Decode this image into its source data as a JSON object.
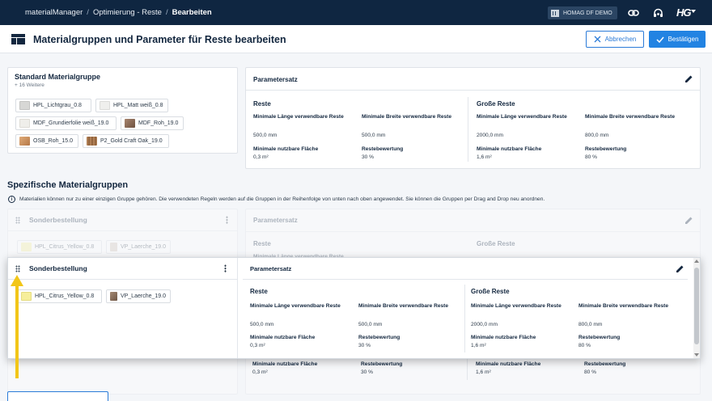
{
  "topnav": {
    "breadcrumbs": [
      "materialManager",
      "Optimierung - Reste",
      "Bearbeiten"
    ],
    "tenant": "HOMAG DF DEMO",
    "logo": "HG"
  },
  "header": {
    "title": "Materialgruppen und Parameter für Reste bearbeiten",
    "cancel_label": "Abbrechen",
    "confirm_label": "Bestätigen"
  },
  "standard": {
    "title": "Standard Materialgruppe",
    "more": "+ 16 Weitere",
    "chips": [
      {
        "label": "HPL_Lichtgrau_0.8",
        "color": "#d7d7d5"
      },
      {
        "label": "HPL_Matt weiß_0.8",
        "color": "#efefed"
      },
      {
        "label": "MDF_Grundierfolie weiß_19.0",
        "color": "#efeeea"
      },
      {
        "label": "MDF_Roh_19.0",
        "color": "#8a6a52"
      },
      {
        "label": "OSB_Roh_15.0",
        "color": "#c98e5a"
      },
      {
        "label": "P2_Gold Craft Oak_19.0",
        "color": "#a0714a"
      }
    ]
  },
  "params_top": {
    "title": "Parametersatz",
    "reste": {
      "title": "Reste",
      "min_len_label": "Minimale Länge verwendbare Reste",
      "min_len": "500,0 mm",
      "min_width_label": "Minimale Breite verwendbare Reste",
      "min_width": "500,0 mm",
      "min_area_label": "Minimale nutzbare Fläche",
      "min_area": "0,3 m²",
      "rating_label": "Restebewertung",
      "rating": "30 %"
    },
    "grosse": {
      "title": "Große Reste",
      "min_len_label": "Minimale Länge verwendbare Reste",
      "min_len": "2000,0 mm",
      "min_width_label": "Minimale Breite verwendbare Reste",
      "min_width": "800,0 mm",
      "min_area_label": "Minimale nutzbare Fläche",
      "min_area": "1,6 m²",
      "rating_label": "Restebewertung",
      "rating": "80 %"
    }
  },
  "specific": {
    "title": "Spezifische Materialgruppen",
    "info": "Materialien können nur zu einer einzigen Gruppe gehören. Die verwendeten Regeln werden auf die Gruppen in der Reihenfolge von unten nach oben angewendet. Sie können die Gruppen per Drag and Drop neu anordnen."
  },
  "group": {
    "title": "Sonderbestellung",
    "chips": [
      {
        "label": "HPL_Citrus_Yellow_0.8",
        "color": "#f6ee9a"
      },
      {
        "label": "VP_Laerche_19.0",
        "color": "#8c7360"
      }
    ],
    "params_title": "Parametersatz"
  },
  "colors": {
    "nav": "#0f2641",
    "accent": "#2283e2",
    "arrow": "#f2c618"
  }
}
